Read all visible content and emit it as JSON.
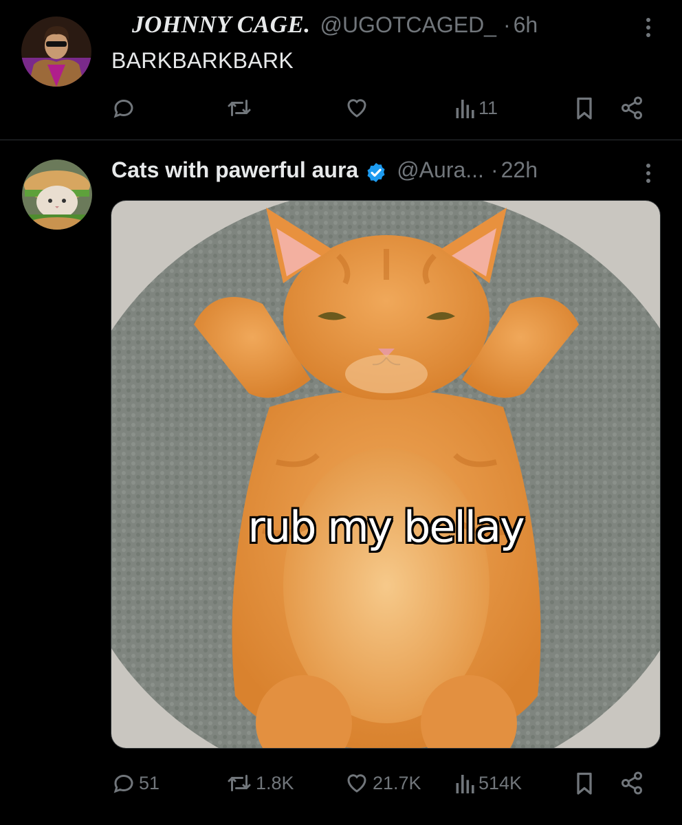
{
  "tweets": [
    {
      "author": "JOHNNY CAGE.",
      "handle": "@UGOTCAGED_",
      "separator": "·",
      "time": "6h",
      "text": "BARKBARKBARK",
      "actions": {
        "reply": "",
        "repost": "",
        "like": "",
        "views": "11"
      }
    },
    {
      "author": "Cats with pawerful aura",
      "handle": "@Aura...",
      "separator": "·",
      "time": "22h",
      "verified": true,
      "media_caption": "rub my bellay",
      "actions": {
        "reply": "51",
        "repost": "1.8K",
        "like": "21.7K",
        "views": "514K"
      }
    }
  ],
  "colors": {
    "background": "#000000",
    "text": "#e7e9ea",
    "secondary": "#71767b",
    "verified": "#1d9bf0",
    "divider": "#2f3336"
  },
  "icons": [
    "reply-icon",
    "repost-icon",
    "like-icon",
    "views-icon",
    "bookmark-icon",
    "share-icon",
    "more-icon",
    "verified-badge-icon"
  ]
}
